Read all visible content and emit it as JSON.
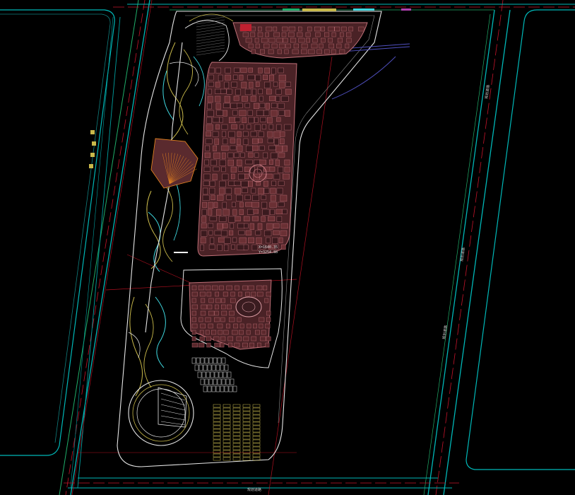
{
  "drawing": {
    "background_color": "#000000",
    "colors": {
      "road_edge": "#00b8b8",
      "road_green": "#1fae6a",
      "centerline": "#c4142a",
      "building_fill": "#7a3c40",
      "building_edge": "#c07078",
      "landscape_yellow": "#c8b84a",
      "landscape_cyan": "#3fd8e0",
      "site_white": "#e6e6e6",
      "accent_magenta": "#b040b0",
      "accent_orange": "#e08020",
      "parking_yellow": "#d0c050"
    },
    "labels": {
      "coord_x": "X=1640.35",
      "coord_y": "Y=3254.88",
      "road_right_1": "规划道路",
      "road_right_2": "规划道路",
      "road_right_3": "规划道路",
      "road_bottom": "规划道路"
    }
  }
}
